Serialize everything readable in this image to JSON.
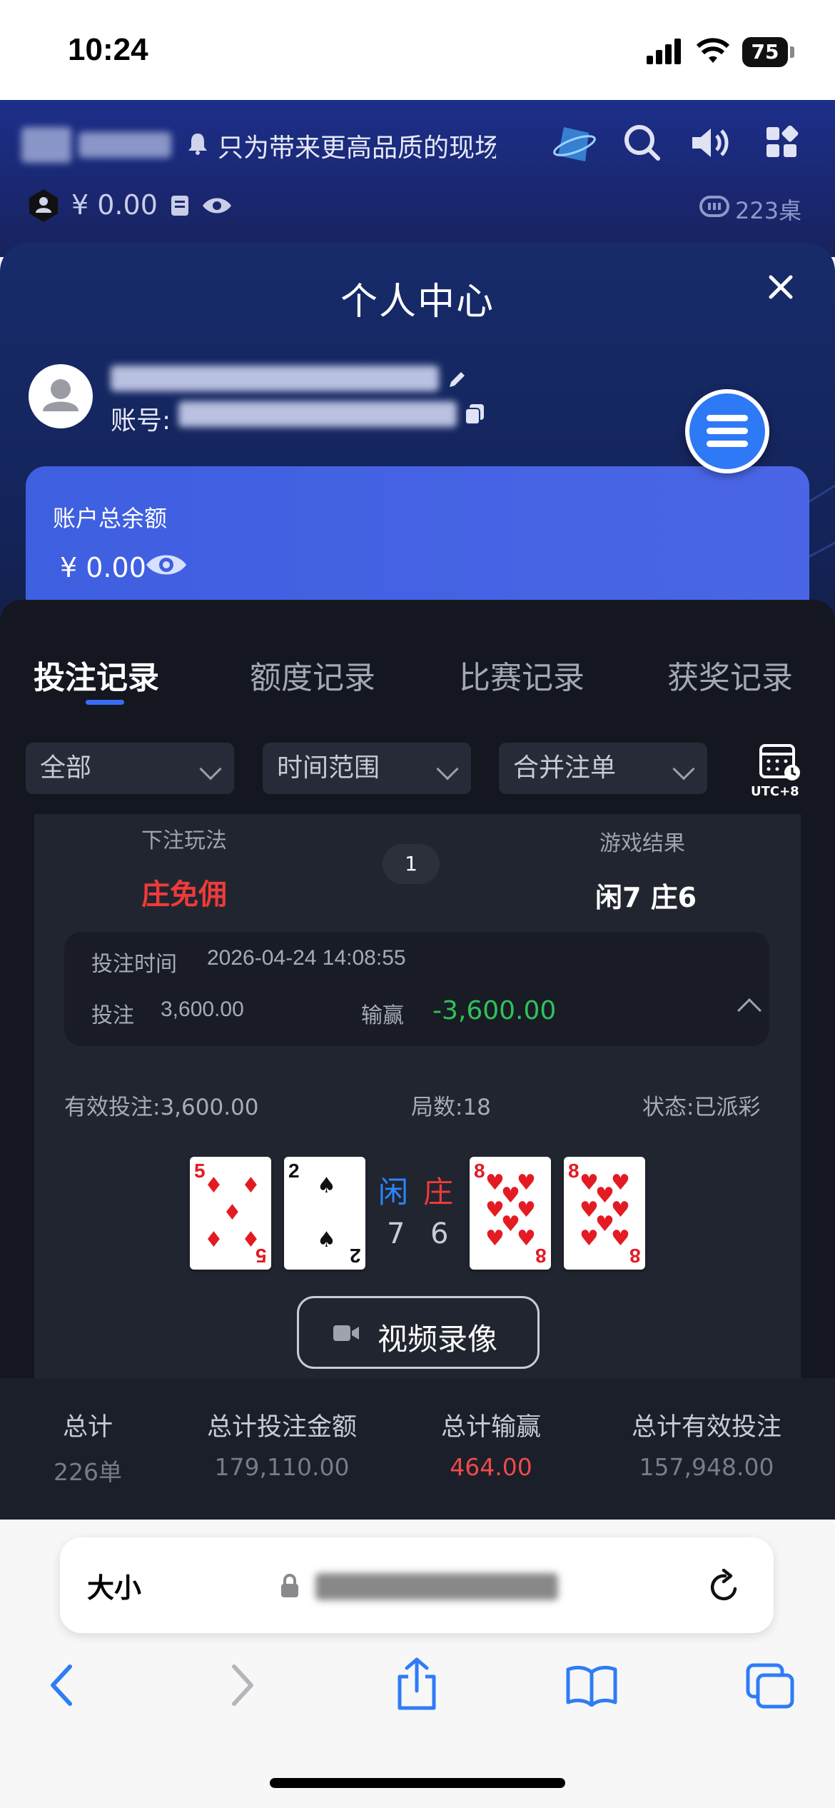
{
  "status_bar": {
    "time": "10:24",
    "battery": "75"
  },
  "header": {
    "marquee": "只为带来更高品质的现场",
    "balance": "¥ 0.00",
    "tables_count": "223桌"
  },
  "modal": {
    "title": "个人中心",
    "account_prefix": "账号:",
    "balance_card": {
      "label": "账户总余额",
      "value": "¥ 0.00"
    }
  },
  "tabs": [
    {
      "label": "投注记录",
      "active": true
    },
    {
      "label": "额度记录",
      "active": false
    },
    {
      "label": "比赛记录",
      "active": false
    },
    {
      "label": "获奖记录",
      "active": false
    }
  ],
  "filters": [
    {
      "value": "全部"
    },
    {
      "value": "时间范围"
    },
    {
      "value": "合并注单"
    }
  ],
  "timezone": "UTC+8",
  "record": {
    "bet_play_label": "下注玩法",
    "bet_play_value": "庄免佣",
    "round": "1",
    "game_result_label": "游戏结果",
    "game_result_value": "闲7 庄6",
    "bet_time_label": "投注时间",
    "bet_time_value": "2026-04-24 14:08:55",
    "bet_label": "投注",
    "bet_value": "3,600.00",
    "winloss_label": "输赢",
    "winloss_value": "-3,600.00",
    "valid_bet": "有效投注:3,600.00",
    "rounds": "局数:18",
    "status": "状态:已派彩",
    "player_label": "闲",
    "banker_label": "庄",
    "player_points": "7",
    "banker_points": "6",
    "player_cards": [
      {
        "rank": "5",
        "suit": "♦"
      },
      {
        "rank": "2",
        "suit": "♠"
      }
    ],
    "banker_cards": [
      {
        "rank": "8",
        "suit": "♥"
      },
      {
        "rank": "8",
        "suit": "♥"
      }
    ],
    "video_button": "视频录像"
  },
  "totals": {
    "headers": [
      "总计",
      "总计投注金额",
      "总计输赢",
      "总计有效投注"
    ],
    "values": [
      "226单",
      "179,110.00",
      "464.00",
      "157,948.00"
    ]
  },
  "safari": {
    "text_size": "大小"
  },
  "colors": {
    "accent": "#3a6cf3",
    "loss": "#2fc25b",
    "banker": "#ef3a3a",
    "player": "#2b86ff"
  }
}
